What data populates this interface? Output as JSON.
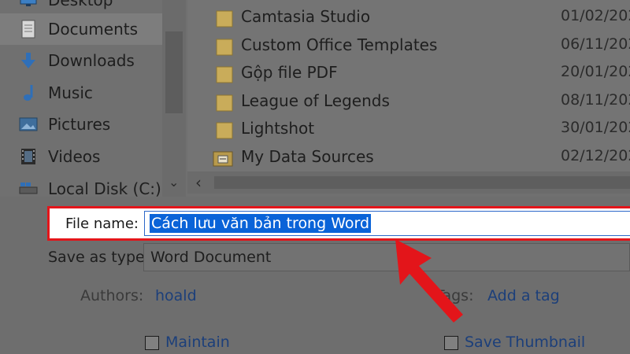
{
  "nav": {
    "items": [
      {
        "label": "Desktop",
        "icon": "desktop-icon"
      },
      {
        "label": "Documents",
        "icon": "documents-icon"
      },
      {
        "label": "Downloads",
        "icon": "downloads-icon"
      },
      {
        "label": "Music",
        "icon": "music-icon"
      },
      {
        "label": "Pictures",
        "icon": "pictures-icon"
      },
      {
        "label": "Videos",
        "icon": "videos-icon"
      },
      {
        "label": "Local Disk (C:)",
        "icon": "local-disk-icon"
      }
    ],
    "selected": "Documents"
  },
  "files": [
    {
      "name": "Camtasia Studio",
      "date": "01/02/202",
      "icon": "folder-icon"
    },
    {
      "name": "Custom Office Templates",
      "date": "06/11/202",
      "icon": "folder-icon"
    },
    {
      "name": "Gộp file PDF",
      "date": "20/01/202",
      "icon": "folder-icon"
    },
    {
      "name": "League of Legends",
      "date": "08/11/202",
      "icon": "folder-icon"
    },
    {
      "name": "Lightshot",
      "date": "30/01/202",
      "icon": "folder-icon"
    },
    {
      "name": "My Data Sources",
      "date": "02/12/202",
      "icon": "data-sources-folder-icon"
    }
  ],
  "form": {
    "file_name_label": "File name:",
    "file_name_value": "Cách lưu văn bản trong Word",
    "save_as_type_label": "Save as type:",
    "save_as_type_value": "Word Document",
    "authors_label": "Authors:",
    "authors_value": "hoald",
    "tags_label": "Tags:",
    "tags_value": "Add a tag",
    "maintain_label": "Maintain",
    "save_thumbnail_label": "Save Thumbnail"
  },
  "colors": {
    "highlight_frame": "#e3151a",
    "selection": "#0a63d8",
    "arrow": "#e3151a"
  }
}
